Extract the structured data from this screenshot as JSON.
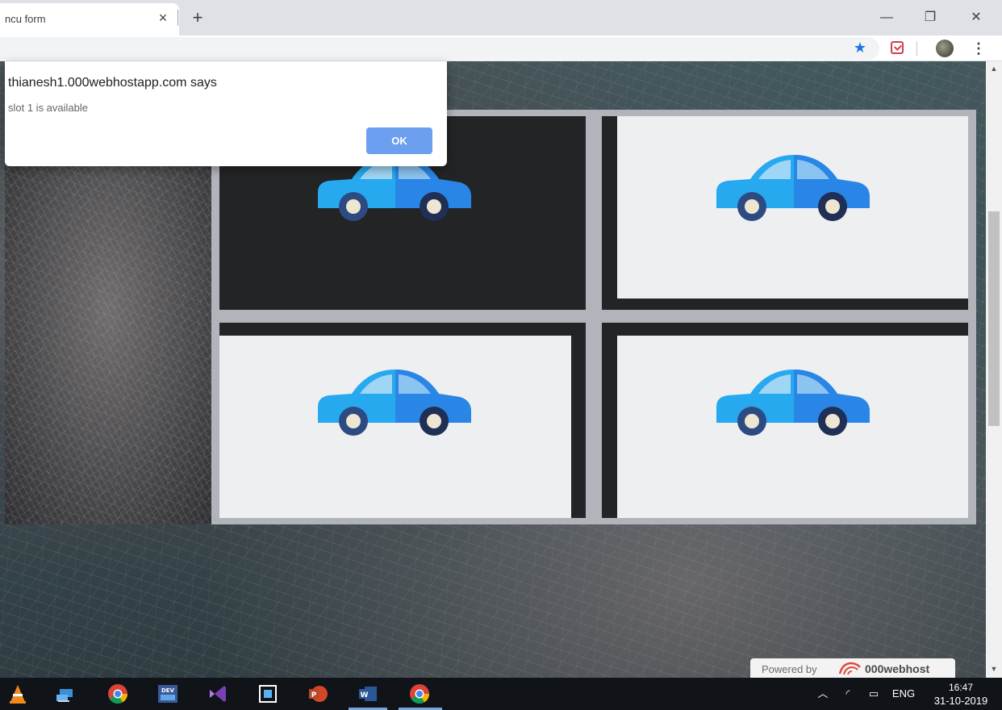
{
  "browser": {
    "tab_title": "ncu form",
    "tab_close": "×",
    "new_tab": "+",
    "window_controls": {
      "minimize": "—",
      "restore": "❐",
      "close": "✕"
    },
    "toolbar_icons": [
      "bookmark-star-icon",
      "pocket-extension-icon",
      "profile-avatar-icon",
      "menu-kebab-icon"
    ]
  },
  "dialog": {
    "title": "thianesh1.000webhostapp.com says",
    "message": "slot 1 is available",
    "ok_label": "OK"
  },
  "parking": {
    "slots": [
      {
        "id": 1,
        "status": "available",
        "icon": "car-icon"
      },
      {
        "id": 2,
        "status": "occupied",
        "icon": "car-icon"
      },
      {
        "id": 3,
        "status": "occupied",
        "icon": "car-icon"
      },
      {
        "id": 4,
        "status": "occupied",
        "icon": "car-icon"
      }
    ],
    "colors": {
      "frame": "#b1b4ba",
      "dark": "#232425",
      "light": "#eeeff1",
      "car_light": "#27a9f0",
      "car_dark": "#2a86e6"
    }
  },
  "badge": {
    "powered_text": "Powered by",
    "brand": "000webhost"
  },
  "taskbar": {
    "apps": [
      "vlc-icon",
      "network-app-icon",
      "chrome-icon",
      "devc-icon",
      "visual-studio-icon",
      "code-editor-icon",
      "powerpoint-icon",
      "word-icon",
      "chrome-active-icon"
    ],
    "tray_language": "ENG",
    "clock_time": "16:47",
    "clock_date": "31-10-2019"
  }
}
